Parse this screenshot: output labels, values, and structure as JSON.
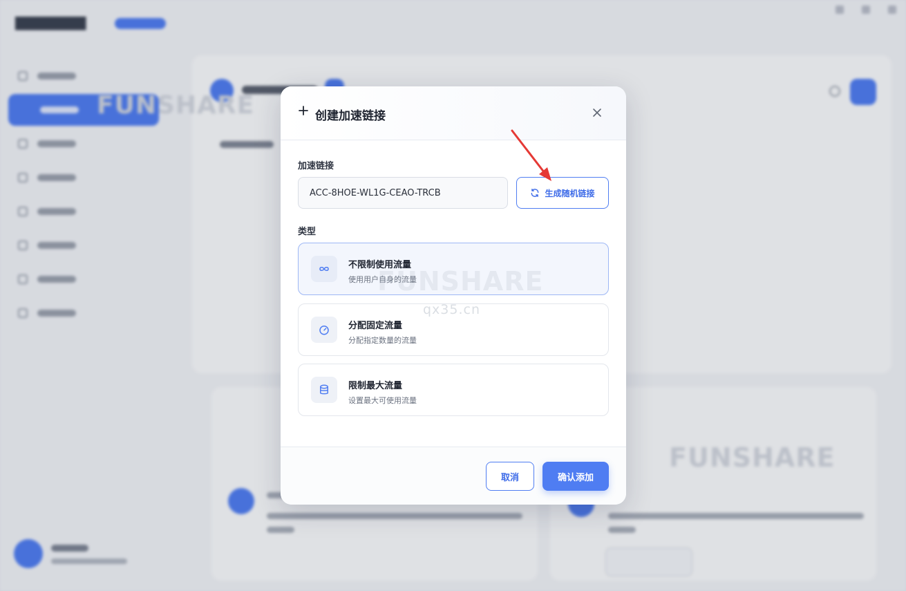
{
  "background": {
    "watermark_top": "FUNSHARE",
    "watermark_bottom": "FUNSHARE"
  },
  "modal": {
    "title": "创建加速链接",
    "close_icon": "close-icon",
    "link_label": "加速链接",
    "link_value": "ACC-8HOE-WL1G-CEAO-TRCB",
    "generate_button": "生成随机链接",
    "type_label": "类型",
    "types": [
      {
        "title": "不限制使用流量",
        "desc": "使用用户自身的流量",
        "icon": "infinity-icon",
        "selected": true
      },
      {
        "title": "分配固定流量",
        "desc": "分配指定数量的流量",
        "icon": "gauge-icon",
        "selected": false
      },
      {
        "title": "限制最大流量",
        "desc": "设置最大可使用流量",
        "icon": "database-icon",
        "selected": false
      }
    ],
    "cancel_button": "取消",
    "confirm_button": "确认添加",
    "watermark": "FUNSHARE",
    "watermark_url": "qx35.cn"
  },
  "colors": {
    "accent": "#4f7df2",
    "annotation_arrow": "#e53935"
  }
}
